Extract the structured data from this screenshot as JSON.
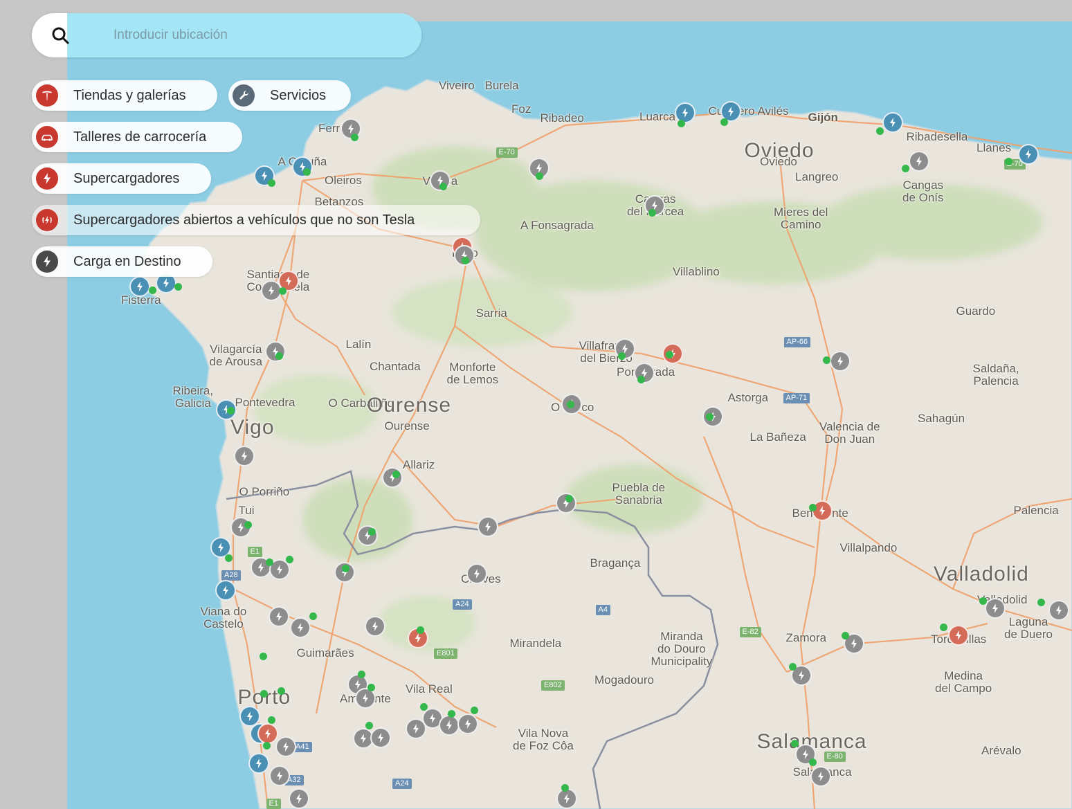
{
  "search": {
    "placeholder": "Introducir ubicación",
    "value": ""
  },
  "filters": [
    {
      "id": "stores",
      "label": "Tiendas y galerías",
      "icon": "tesla-logo-icon",
      "color": "#c8382e"
    },
    {
      "id": "service",
      "label": "Servicios",
      "icon": "wrench-icon",
      "color": "#5a6a78"
    },
    {
      "id": "bodyshop",
      "label": "Talleres de carrocería",
      "icon": "car-icon",
      "color": "#c8382e"
    },
    {
      "id": "superchargers",
      "label": "Supercargadores",
      "icon": "bolt-icon",
      "color": "#c8382e"
    },
    {
      "id": "open_superchargers",
      "label": "Supercargadores abiertos a vehículos que no son Tesla",
      "icon": "bolt-signal-icon",
      "color": "#c8382e"
    },
    {
      "id": "destination",
      "label": "Carga en Destino",
      "icon": "bolt-icon",
      "color": "#4a4a4a"
    }
  ],
  "map": {
    "colors": {
      "sea": "#8ccde3",
      "land": "#e9e5dc",
      "forest": "#cfdfbc",
      "road": "#f0a06a",
      "border": "#8a8f9f"
    },
    "labels": {
      "viveiro": "Viveiro",
      "burela": "Burela",
      "foz": "Foz",
      "ribadeo": "Ribadeo",
      "luarca": "Luarca",
      "cudillero": "Cudillero",
      "aviles": "Avilés",
      "gijon": "Gijón",
      "ribadesella": "Ribadesella",
      "llanes": "Llanes",
      "oviedo": "Oviedo",
      "oviedo_small": "Oviedo",
      "langreo": "Langreo",
      "ferrol": "Ferrol",
      "a_coruna": "A Coruña",
      "oleiros": "Oleiros",
      "betanzos": "Betanzos",
      "vilalba": "Vilalba",
      "cangas_narcea": "Cangas\ndel Narcea",
      "cangas_onis": "Cangas\nde Onís",
      "mieres": "Mieres del\nCamino",
      "fonsagrada": "A Fonsagrada",
      "lugo": "Lugo",
      "villablino": "Villablino",
      "santiago": "Santiago de\nCompostela",
      "fisterra": "Fisterra",
      "sarria": "Sarria",
      "guardo": "Guardo",
      "vilagarcia": "Vilagarcía\nde Arousa",
      "lalin": "Lalín",
      "chantada": "Chantada",
      "monforte": "Monforte\nde Lemos",
      "villafranca": "Villafranca\ndel Bierzo",
      "ponferrada": "Ponferrada",
      "saldana": "Saldaña,\nPalencia",
      "ribeira": "Ribeira,\nGalicia",
      "pontevedra": "Pontevedra",
      "carballino": "O Carballiño",
      "ourense_big": "Ourense",
      "ourense": "Ourense",
      "o_barco": "O Barco",
      "astorga": "Astorga",
      "vigo": "Vigo",
      "valencia_don_juan": "Valencia de\nDon Juan",
      "sahagun": "Sahagún",
      "la_baneza": "La Bañeza",
      "allariz": "Allariz",
      "o_porrino": "O Porriño",
      "puebla_sanabria": "Puebla de\nSanabria",
      "tui": "Tui",
      "benavente": "Benavente",
      "palencia": "Palencia",
      "villalpando": "Villalpando",
      "bragança": "Bragança",
      "chaves": "Chaves",
      "valladolid_big": "Valladolid",
      "valladolid": "Valladolid",
      "viana": "Viana do\nCastelo",
      "laguna": "Laguna\nde Duero",
      "tordesillas": "Tordesillas",
      "zamora": "Zamora",
      "miranda": "Miranda\ndo Douro\nMunicipality",
      "mirandela": "Mirandela",
      "guimaraes": "Guimarães",
      "medina": "Medina\ndel Campo",
      "mogadouro": "Mogadouro",
      "vila_real": "Vila Real",
      "amarante": "Amarante",
      "porto": "Porto",
      "vila_nova": "Vila Nova\nde Foz Côa",
      "salamanca_big": "Salamanca",
      "salamanca": "Salamanca",
      "arevalo": "Arévalo"
    },
    "roads": {
      "e70a": "E-70",
      "e70b": "E-70",
      "ap66": "AP-66",
      "ap71": "AP-71",
      "a24a": "A24",
      "a4": "A4",
      "e82": "E-82",
      "e801": "E801",
      "e802": "E802",
      "a28": "A28",
      "e1a": "E1",
      "e1b": "E1",
      "a41": "A41",
      "a32": "A32",
      "a24b": "A24",
      "e80": "E-80"
    }
  }
}
